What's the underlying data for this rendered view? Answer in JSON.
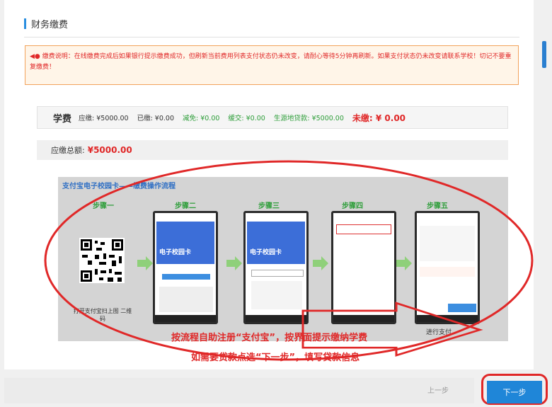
{
  "section": {
    "title": "财务缴费"
  },
  "notice": {
    "icon": "horn-icon",
    "text": "缴费说明：在线缴费完成后如果银行提示缴费成功，但刷新当前费用列表支付状态仍未改变，请耐心等待5分钟再刷新。如果支付状态仍未改变请联系学校！切记不要重复缴费！"
  },
  "fee": {
    "name": "学费",
    "due_amount": "应缴: ¥5000.00",
    "paid": "已缴: ¥0.00",
    "reduced": "减免: ¥0.00",
    "deferred": "缓交: ¥0.00",
    "loan": "生源地贷款: ¥5000.00",
    "unpaid": "未缴: ¥  0.00"
  },
  "total": {
    "label": "应缴总额:",
    "amount": "¥5000.00"
  },
  "flow": {
    "title": "支付宝电子校园卡——缴费操作流程",
    "steps": [
      "步骤一",
      "步骤二",
      "步骤三",
      "步骤四",
      "步骤五"
    ],
    "step1_caption": "打开支付宝扫上图 二维码",
    "phone_banner": "电子校园卡",
    "step5_caption": "进行支付"
  },
  "overlay": {
    "line1": "按流程自助注册“支付宝”，按界面提示缴纳学费",
    "line2": "如需要贷款点选“下一步”，填写贷款信息"
  },
  "footer": {
    "prev_label": "上一步",
    "next_label": "下一步"
  },
  "colors": {
    "accent": "#1f86d8",
    "alert": "#e02828",
    "green": "#2e9e3a"
  }
}
